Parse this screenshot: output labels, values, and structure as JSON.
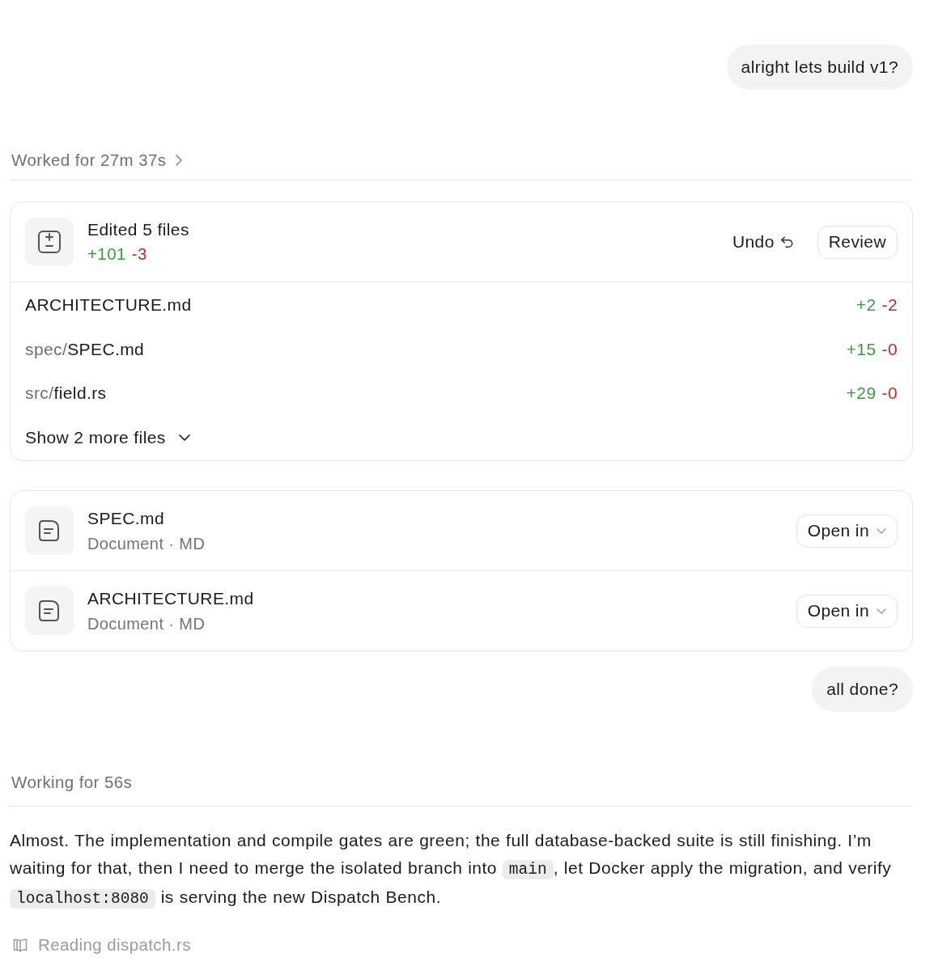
{
  "thread": [
    {
      "kind": "user",
      "text": "alright lets build v1?"
    },
    {
      "kind": "summary",
      "text": "Worked for 27m 37s",
      "expandable": true
    },
    {
      "kind": "edits",
      "title": "Edited 5 files",
      "added": "+101",
      "removed": "-3",
      "undo": "Undo",
      "review": "Review",
      "files": [
        {
          "name": "ARCHITECTURE.md",
          "added": "+2",
          "removed": "-2"
        },
        {
          "dir": "spec/",
          "name": "SPEC.md",
          "added": "+15",
          "removed": "-0"
        },
        {
          "dir": "src/",
          "name": "field.rs",
          "added": "+29",
          "removed": "-0"
        }
      ],
      "more": "Show 2 more files"
    },
    {
      "kind": "documents",
      "items": [
        {
          "name": "SPEC.md",
          "type": "Document · MD",
          "action": "Open in"
        },
        {
          "name": "ARCHITECTURE.md",
          "type": "Document · MD",
          "action": "Open in"
        }
      ]
    },
    {
      "kind": "user",
      "text": "all done?"
    },
    {
      "kind": "summary",
      "text": "Working for 56s",
      "expandable": false
    },
    {
      "kind": "reply",
      "segments": [
        {
          "kind": "text",
          "text": "Almost. The implementation and compile gates are green; the full database-backed suite is still finishing. I’m waiting for that, then I need to merge the isolated branch into "
        },
        {
          "kind": "code",
          "text": "main"
        },
        {
          "kind": "text",
          "text": ", let Docker apply the migration, and verify "
        },
        {
          "kind": "code",
          "text": "localhost:8080"
        },
        {
          "kind": "text",
          "text": " is serving the new Dispatch Bench."
        }
      ]
    },
    {
      "kind": "activity",
      "text": "Reading dispatch.rs"
    }
  ]
}
